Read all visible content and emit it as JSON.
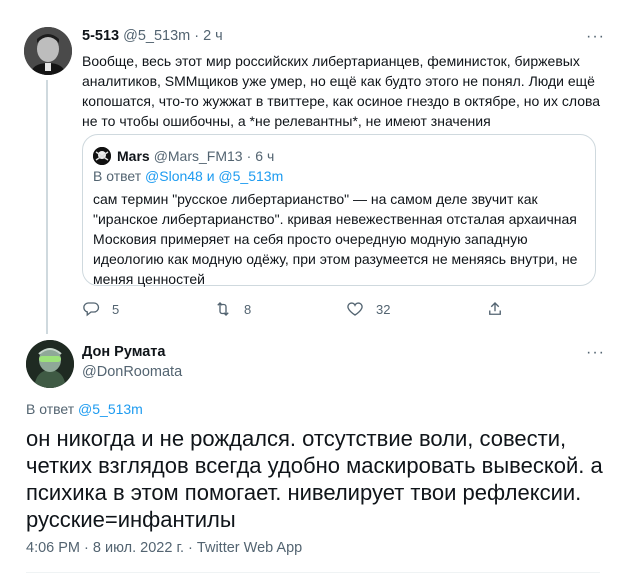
{
  "parent_tweet": {
    "author_name": "5-513",
    "author_handle": "@5_513m",
    "separator": "·",
    "time": "2 ч",
    "text": "Вообще, весь этот мир российских либертарианцев, феминисток, биржевых аналитиков, SMMщиков уже умер, но ещё как будто этого не понял. Люди ещё копошатся, что-то жужжат в твиттере, как осиное гнездо в октябре, но их слова не то чтобы ошибочны, а *не релевантны*, не имеют значения",
    "more_label": "···",
    "quote": {
      "author_name": "Mars",
      "author_handle": "@Mars_FM13",
      "separator": "·",
      "time": "6 ч",
      "reply_prefix": "В ответ",
      "reply_to": "@Slon48 и @5_513m",
      "text": "сам термин \"русское либертарианство\" — на самом деле звучит как \"иранское либертарианство\". кривая невежественная отсталая архаичная Московия примеряет на себя просто очередную модную западную идеологию как модную одёжу, при этом разумеется не меняясь внутри, не меняя ценностей"
    },
    "actions": {
      "replies": "5",
      "retweets": "8",
      "likes": "32"
    }
  },
  "main_tweet": {
    "author_name": "Дон Румата",
    "author_handle": "@DonRoomata",
    "more_label": "···",
    "reply_prefix": "В ответ",
    "reply_to": "@5_513m",
    "text": "он никогда и не рождался. отсутствие воли, совести, четких взглядов всегда удобно маскировать вывеской. а психика в этом помогает. нивелирует твои рефлексии. русские=инфантилы",
    "time": "4:06 PM",
    "separator": "·",
    "date": "8 июл. 2022 г.",
    "separator2": "·",
    "source": "Twitter Web App"
  },
  "colors": {
    "accent": "#1d9bf0",
    "secondary_text": "#536471",
    "border": "#cfd9de"
  },
  "icons": [
    "reply-icon",
    "retweet-icon",
    "like-icon",
    "share-icon",
    "more-icon"
  ]
}
